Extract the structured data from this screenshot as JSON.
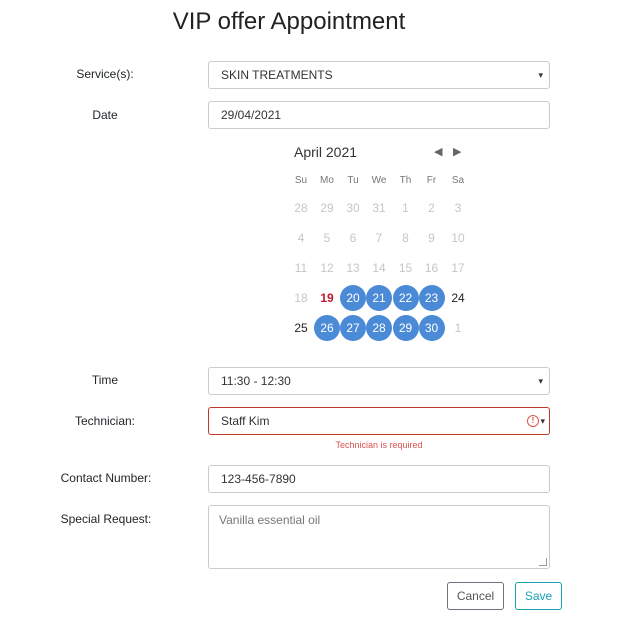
{
  "title": "VIP offer Appointment",
  "service": {
    "label": "Service(s):",
    "value": "SKIN TREATMENTS"
  },
  "date": {
    "label": "Date",
    "value": "29/04/2021"
  },
  "calendar": {
    "month_label": "April 2021",
    "weekdays": [
      "Su",
      "Mo",
      "Tu",
      "We",
      "Th",
      "Fr",
      "Sa"
    ],
    "weeks": [
      [
        {
          "d": "28",
          "s": "muted"
        },
        {
          "d": "29",
          "s": "muted"
        },
        {
          "d": "30",
          "s": "muted"
        },
        {
          "d": "31",
          "s": "muted"
        },
        {
          "d": "1",
          "s": "muted"
        },
        {
          "d": "2",
          "s": "muted"
        },
        {
          "d": "3",
          "s": "muted"
        }
      ],
      [
        {
          "d": "4",
          "s": "muted"
        },
        {
          "d": "5",
          "s": "muted"
        },
        {
          "d": "6",
          "s": "muted"
        },
        {
          "d": "7",
          "s": "muted"
        },
        {
          "d": "8",
          "s": "muted"
        },
        {
          "d": "9",
          "s": "muted"
        },
        {
          "d": "10",
          "s": "muted"
        }
      ],
      [
        {
          "d": "11",
          "s": "muted"
        },
        {
          "d": "12",
          "s": "muted"
        },
        {
          "d": "13",
          "s": "muted"
        },
        {
          "d": "14",
          "s": "muted"
        },
        {
          "d": "15",
          "s": "muted"
        },
        {
          "d": "16",
          "s": "muted"
        },
        {
          "d": "17",
          "s": "muted"
        }
      ],
      [
        {
          "d": "18",
          "s": "muted"
        },
        {
          "d": "19",
          "s": "today"
        },
        {
          "d": "20",
          "s": "avail"
        },
        {
          "d": "21",
          "s": "avail"
        },
        {
          "d": "22",
          "s": "avail"
        },
        {
          "d": "23",
          "s": "avail"
        },
        {
          "d": "24",
          "s": "normal"
        }
      ],
      [
        {
          "d": "25",
          "s": "normal"
        },
        {
          "d": "26",
          "s": "avail"
        },
        {
          "d": "27",
          "s": "avail"
        },
        {
          "d": "28",
          "s": "avail"
        },
        {
          "d": "29",
          "s": "avail"
        },
        {
          "d": "30",
          "s": "avail"
        },
        {
          "d": "1",
          "s": "muted"
        }
      ]
    ],
    "highlight_color": "#4a8ad6",
    "today_color": "#c0172b"
  },
  "time": {
    "label": "Time",
    "value": "11:30 - 12:30"
  },
  "technician": {
    "label": "Technician:",
    "value": "Staff Kim",
    "error": "Technician is required",
    "error_icon": "!"
  },
  "contact": {
    "label": "Contact Number:",
    "value": "123-456-7890"
  },
  "special_request": {
    "label": "Special Request:",
    "value": "Vanilla essential oil"
  },
  "buttons": {
    "cancel": "Cancel",
    "save": "Save"
  },
  "icons": {
    "select_arrow": "▾",
    "prev": "◀",
    "next": "▶"
  }
}
